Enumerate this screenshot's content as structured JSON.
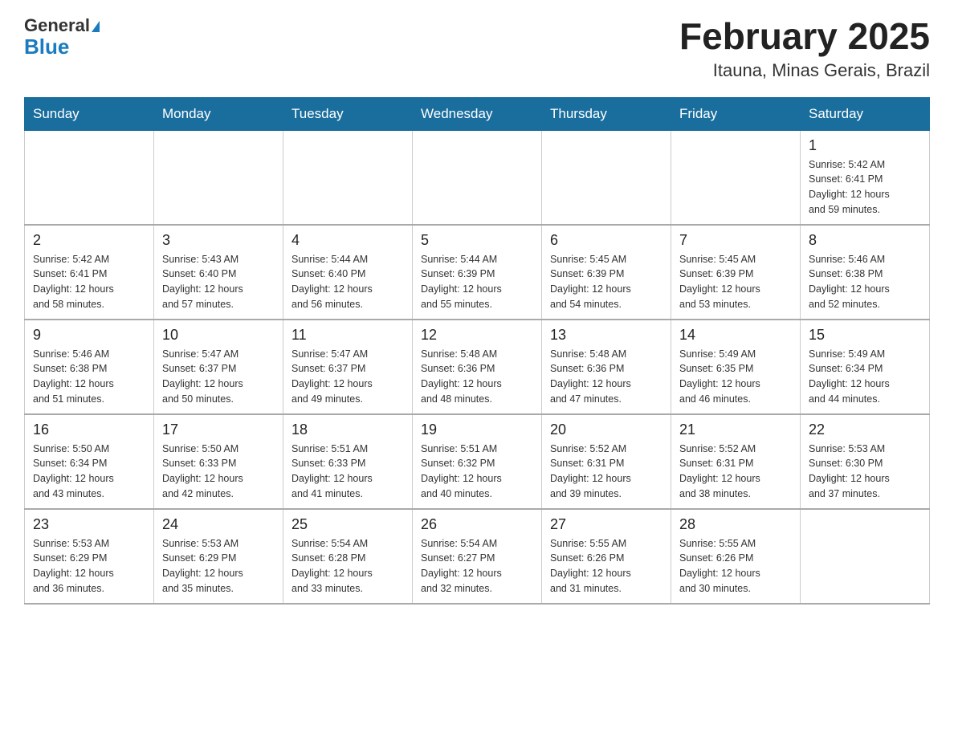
{
  "header": {
    "logo_general": "General",
    "logo_blue": "Blue",
    "title": "February 2025",
    "subtitle": "Itauna, Minas Gerais, Brazil"
  },
  "days_of_week": [
    "Sunday",
    "Monday",
    "Tuesday",
    "Wednesday",
    "Thursday",
    "Friday",
    "Saturday"
  ],
  "weeks": [
    [
      {
        "day": "",
        "info": ""
      },
      {
        "day": "",
        "info": ""
      },
      {
        "day": "",
        "info": ""
      },
      {
        "day": "",
        "info": ""
      },
      {
        "day": "",
        "info": ""
      },
      {
        "day": "",
        "info": ""
      },
      {
        "day": "1",
        "info": "Sunrise: 5:42 AM\nSunset: 6:41 PM\nDaylight: 12 hours\nand 59 minutes."
      }
    ],
    [
      {
        "day": "2",
        "info": "Sunrise: 5:42 AM\nSunset: 6:41 PM\nDaylight: 12 hours\nand 58 minutes."
      },
      {
        "day": "3",
        "info": "Sunrise: 5:43 AM\nSunset: 6:40 PM\nDaylight: 12 hours\nand 57 minutes."
      },
      {
        "day": "4",
        "info": "Sunrise: 5:44 AM\nSunset: 6:40 PM\nDaylight: 12 hours\nand 56 minutes."
      },
      {
        "day": "5",
        "info": "Sunrise: 5:44 AM\nSunset: 6:39 PM\nDaylight: 12 hours\nand 55 minutes."
      },
      {
        "day": "6",
        "info": "Sunrise: 5:45 AM\nSunset: 6:39 PM\nDaylight: 12 hours\nand 54 minutes."
      },
      {
        "day": "7",
        "info": "Sunrise: 5:45 AM\nSunset: 6:39 PM\nDaylight: 12 hours\nand 53 minutes."
      },
      {
        "day": "8",
        "info": "Sunrise: 5:46 AM\nSunset: 6:38 PM\nDaylight: 12 hours\nand 52 minutes."
      }
    ],
    [
      {
        "day": "9",
        "info": "Sunrise: 5:46 AM\nSunset: 6:38 PM\nDaylight: 12 hours\nand 51 minutes."
      },
      {
        "day": "10",
        "info": "Sunrise: 5:47 AM\nSunset: 6:37 PM\nDaylight: 12 hours\nand 50 minutes."
      },
      {
        "day": "11",
        "info": "Sunrise: 5:47 AM\nSunset: 6:37 PM\nDaylight: 12 hours\nand 49 minutes."
      },
      {
        "day": "12",
        "info": "Sunrise: 5:48 AM\nSunset: 6:36 PM\nDaylight: 12 hours\nand 48 minutes."
      },
      {
        "day": "13",
        "info": "Sunrise: 5:48 AM\nSunset: 6:36 PM\nDaylight: 12 hours\nand 47 minutes."
      },
      {
        "day": "14",
        "info": "Sunrise: 5:49 AM\nSunset: 6:35 PM\nDaylight: 12 hours\nand 46 minutes."
      },
      {
        "day": "15",
        "info": "Sunrise: 5:49 AM\nSunset: 6:34 PM\nDaylight: 12 hours\nand 44 minutes."
      }
    ],
    [
      {
        "day": "16",
        "info": "Sunrise: 5:50 AM\nSunset: 6:34 PM\nDaylight: 12 hours\nand 43 minutes."
      },
      {
        "day": "17",
        "info": "Sunrise: 5:50 AM\nSunset: 6:33 PM\nDaylight: 12 hours\nand 42 minutes."
      },
      {
        "day": "18",
        "info": "Sunrise: 5:51 AM\nSunset: 6:33 PM\nDaylight: 12 hours\nand 41 minutes."
      },
      {
        "day": "19",
        "info": "Sunrise: 5:51 AM\nSunset: 6:32 PM\nDaylight: 12 hours\nand 40 minutes."
      },
      {
        "day": "20",
        "info": "Sunrise: 5:52 AM\nSunset: 6:31 PM\nDaylight: 12 hours\nand 39 minutes."
      },
      {
        "day": "21",
        "info": "Sunrise: 5:52 AM\nSunset: 6:31 PM\nDaylight: 12 hours\nand 38 minutes."
      },
      {
        "day": "22",
        "info": "Sunrise: 5:53 AM\nSunset: 6:30 PM\nDaylight: 12 hours\nand 37 minutes."
      }
    ],
    [
      {
        "day": "23",
        "info": "Sunrise: 5:53 AM\nSunset: 6:29 PM\nDaylight: 12 hours\nand 36 minutes."
      },
      {
        "day": "24",
        "info": "Sunrise: 5:53 AM\nSunset: 6:29 PM\nDaylight: 12 hours\nand 35 minutes."
      },
      {
        "day": "25",
        "info": "Sunrise: 5:54 AM\nSunset: 6:28 PM\nDaylight: 12 hours\nand 33 minutes."
      },
      {
        "day": "26",
        "info": "Sunrise: 5:54 AM\nSunset: 6:27 PM\nDaylight: 12 hours\nand 32 minutes."
      },
      {
        "day": "27",
        "info": "Sunrise: 5:55 AM\nSunset: 6:26 PM\nDaylight: 12 hours\nand 31 minutes."
      },
      {
        "day": "28",
        "info": "Sunrise: 5:55 AM\nSunset: 6:26 PM\nDaylight: 12 hours\nand 30 minutes."
      },
      {
        "day": "",
        "info": ""
      }
    ]
  ]
}
